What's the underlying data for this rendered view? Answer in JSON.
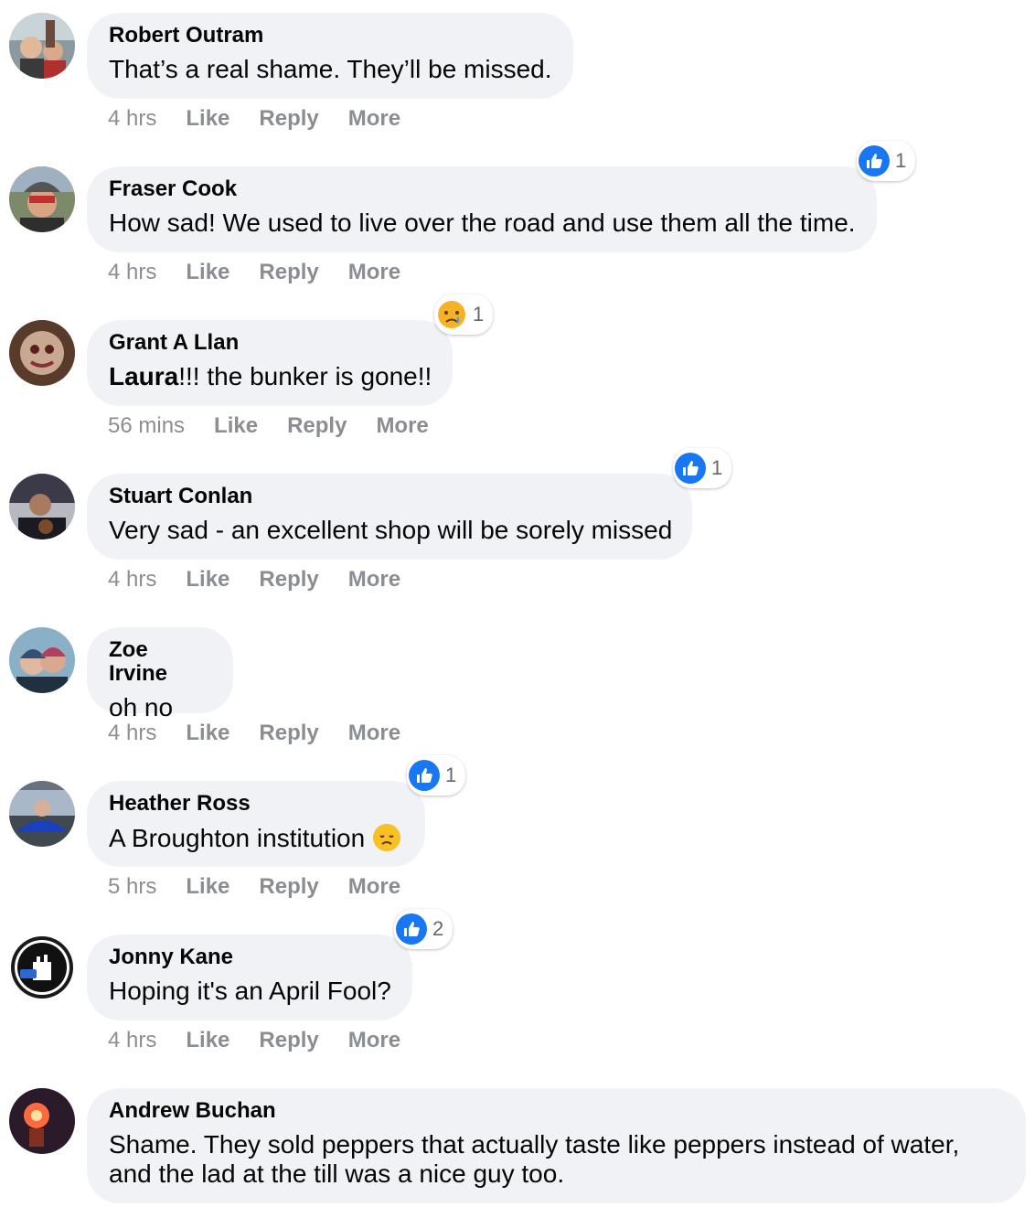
{
  "comments": [
    {
      "author": "Robert Outram",
      "text": "That’s a real shame. They’ll be missed.",
      "time": "4 hrs",
      "like": "Like",
      "reply": "Reply",
      "more": "More",
      "reaction": null,
      "reaction_count": ""
    },
    {
      "author": "Fraser Cook",
      "text": "How sad! We used to live over the road and use them all the time.",
      "time": "4 hrs",
      "like": "Like",
      "reply": "Reply",
      "more": "More",
      "reaction": "like-icon",
      "reaction_count": "1"
    },
    {
      "author": "Grant A Llan",
      "mention": "Laura",
      "text": "!!! the bunker is gone!!",
      "time": "56 mins",
      "like": "Like",
      "reply": "Reply",
      "more": "More",
      "reaction": "sad-crying-icon",
      "reaction_count": "1"
    },
    {
      "author": "Stuart Conlan",
      "text": "Very sad - an excellent shop will be sorely missed",
      "time": "4 hrs",
      "like": "Like",
      "reply": "Reply",
      "more": "More",
      "reaction": "like-icon",
      "reaction_count": "1"
    },
    {
      "author": "Zoe Irvine",
      "text": "oh no",
      "time": "4 hrs",
      "like": "Like",
      "reply": "Reply",
      "more": "More",
      "reaction": null,
      "reaction_count": ""
    },
    {
      "author": "Heather Ross",
      "text": "A Broughton institution",
      "time": "5 hrs",
      "like": "Like",
      "reply": "Reply",
      "more": "More",
      "reaction": "like-icon",
      "reaction_count": "1",
      "inline_emoji": "disappointed-face-icon"
    },
    {
      "author": "Jonny Kane",
      "text": "Hoping it's an April Fool?",
      "time": "4 hrs",
      "like": "Like",
      "reply": "Reply",
      "more": "More",
      "reaction": "like-icon",
      "reaction_count": "2"
    },
    {
      "author": "Andrew Buchan",
      "text": "Shame. They sold peppers that actually taste like peppers instead of water, and the lad at the till was a nice guy too.",
      "time": "",
      "like": "",
      "reply": "",
      "more": "",
      "reaction": null,
      "reaction_count": ""
    }
  ],
  "colors": {
    "bubble": "#f0f2f5",
    "meta": "#8a8d91",
    "like_blue": "#1877f2"
  }
}
